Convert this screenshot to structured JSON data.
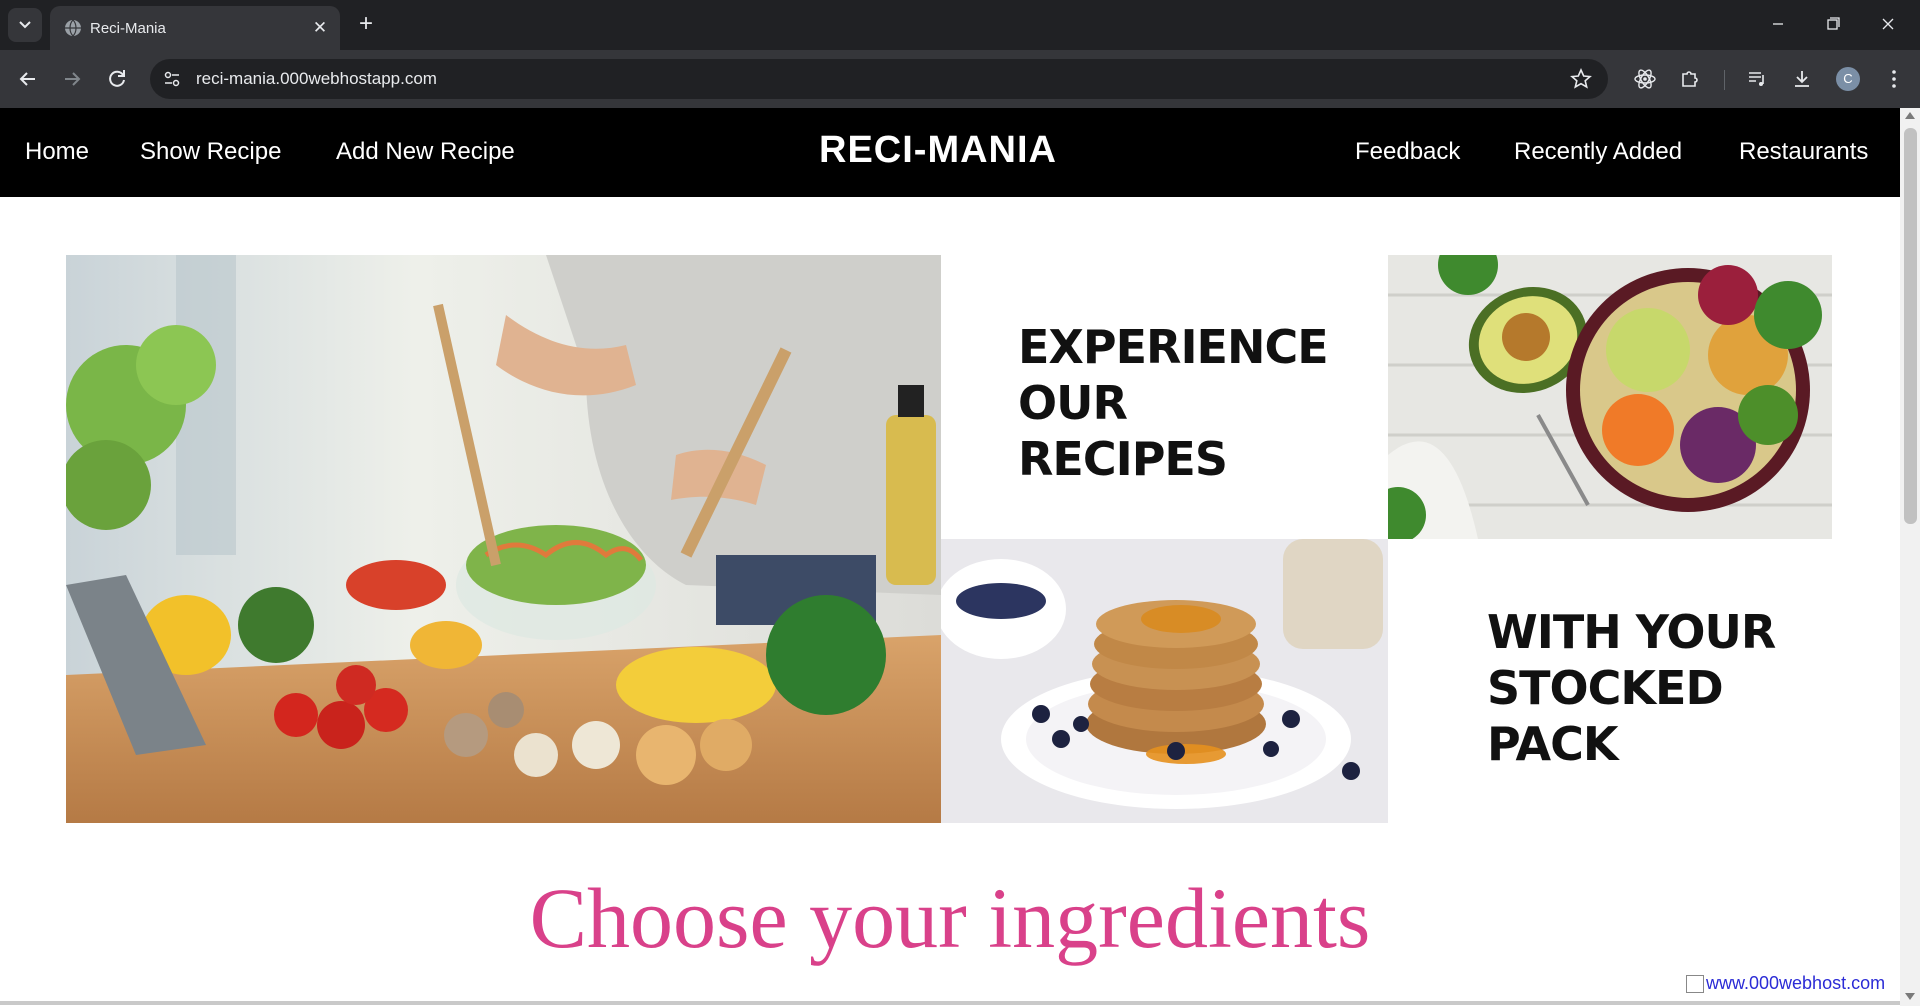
{
  "browser": {
    "tab_title": "Reci-Mania",
    "url": "reci-mania.000webhostapp.com",
    "profile_initial": "C",
    "icons": [
      "tab-search-icon",
      "globe-icon",
      "close-icon",
      "plus-icon",
      "minimize-icon",
      "restore-icon",
      "window-close-icon",
      "back-arrow-icon",
      "forward-arrow-icon",
      "reload-icon",
      "site-info-icon",
      "star-icon",
      "react-extension-icon",
      "puzzle-icon",
      "media-control-icon",
      "download-icon",
      "kebab-menu-icon"
    ]
  },
  "site": {
    "nav_left": [
      "Home",
      "Show Recipe",
      "Add New Recipe"
    ],
    "brand": "RECI-MANIA",
    "nav_right": [
      "Feedback",
      "Recently Added",
      "Restaurants"
    ]
  },
  "hero": {
    "text_1": [
      "EXPERIENCE",
      "OUR",
      "RECIPES"
    ],
    "text_2": [
      "WITH YOUR",
      "STOCKED",
      "PACK"
    ]
  },
  "heading": "Choose your ingredients",
  "hosting_badge": "www.000webhost.com",
  "colors": {
    "nav_bg": "#000000",
    "heading": "#d9418a",
    "chrome_dark": "#202124",
    "chrome_toolbar": "#35363a"
  }
}
